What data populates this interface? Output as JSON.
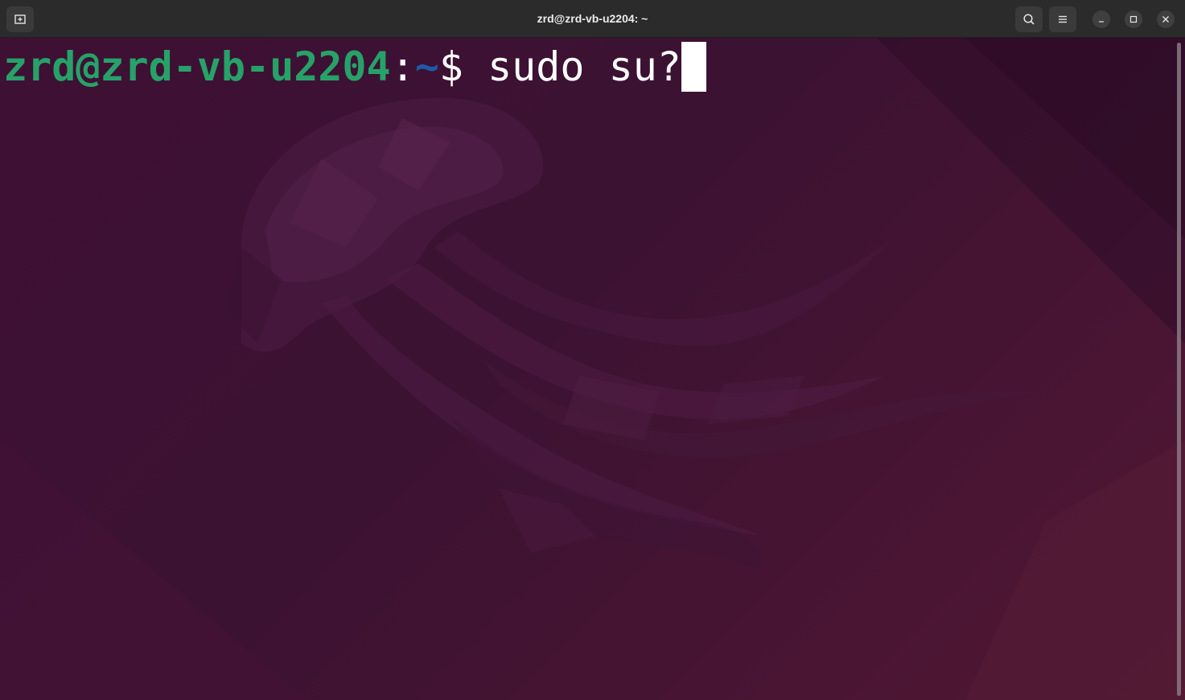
{
  "window": {
    "title": "zrd@zrd-vb-u2204: ~"
  },
  "titlebar": {
    "new_tab_icon": "new-tab-icon",
    "search_icon": "search-icon",
    "menu_icon": "hamburger-menu-icon",
    "minimize_icon": "minimize-icon",
    "maximize_icon": "maximize-icon",
    "close_icon": "close-icon"
  },
  "terminal": {
    "prompt_user_host": "zrd@zrd-vb-u2204",
    "prompt_colon": ":",
    "prompt_path": "~",
    "prompt_symbol": "$ ",
    "command": "sudo su?"
  },
  "colors": {
    "titlebar_bg": "#2b2b2b",
    "terminal_bg": "#3c1232",
    "prompt_user_color": "#26a269",
    "prompt_path_color": "#1e5aa8",
    "text_color": "#ffffff"
  }
}
